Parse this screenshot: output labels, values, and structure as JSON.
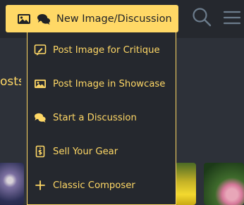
{
  "toolbar": {
    "new_button_label": "New Image/Discussion",
    "new_button_icons": [
      "image-icon",
      "chat-bubbles-icon"
    ],
    "search_icon": "search-icon",
    "menu_icon": "hamburger-menu-icon"
  },
  "background": {
    "partial_heading": "osts"
  },
  "dropdown": {
    "items": [
      {
        "label": "Post Image for Critique",
        "icon": "critique-icon"
      },
      {
        "label": "Post Image in Showcase",
        "icon": "image-icon"
      },
      {
        "label": "Start a Discussion",
        "icon": "chat-bubbles-icon"
      },
      {
        "label": "Sell Your Gear",
        "icon": "price-tag-icon"
      },
      {
        "label": "Classic Composer",
        "icon": "plus-icon"
      }
    ]
  },
  "colors": {
    "accent": "#ffd866",
    "panel": "#25282e",
    "page_bg": "#2d3139"
  }
}
